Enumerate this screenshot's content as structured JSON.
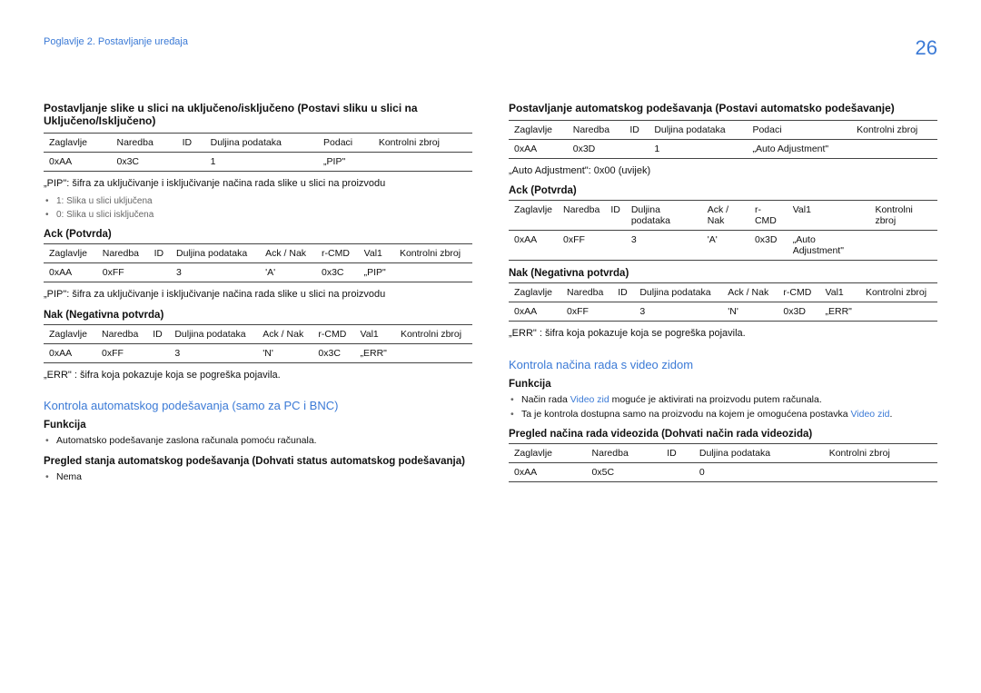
{
  "chapter": "Poglavlje 2. Postavljanje uređaja",
  "page": "26",
  "left": {
    "title1": "Postavljanje slike u slici na uključeno/isključeno (Postavi sliku u slici na Uključeno/Isključeno)",
    "t1h": [
      "Zaglavlje",
      "Naredba",
      "ID",
      "Duljina podataka",
      "Podaci",
      "Kontrolni zbroj"
    ],
    "t1r": [
      "0xAA",
      "0x3C",
      "",
      "1",
      "„PIP\"",
      ""
    ],
    "desc1": "„PIP\": šifra za uključivanje i isključivanje načina rada slike u slici na proizvodu",
    "b1": "1: Slika u slici uključena",
    "b2": "0: Slika u slici isključena",
    "ack": "Ack (Potvrda)",
    "t2h": [
      "Zaglavlje",
      "Naredba",
      "ID",
      "Duljina podataka",
      "Ack / Nak",
      "r-CMD",
      "Val1",
      "Kontrolni zbroj"
    ],
    "t2r": [
      "0xAA",
      "0xFF",
      "",
      "3",
      "'A'",
      "0x3C",
      "„PIP\"",
      ""
    ],
    "desc2": "„PIP\": šifra za uključivanje i isključivanje načina rada slike u slici na proizvodu",
    "nak": "Nak (Negativna potvrda)",
    "t3r": [
      "0xAA",
      "0xFF",
      "",
      "3",
      "'N'",
      "0x3C",
      "„ERR\"",
      ""
    ],
    "err": "„ERR\" : šifra koja pokazuje koja se pogreška pojavila.",
    "sec": "Kontrola automatskog podešavanja (samo za PC i BNC)",
    "func": "Funkcija",
    "fb1": "Automatsko podešavanje zaslona računala pomoću računala.",
    "preg": "Pregled stanja automatskog podešavanja (Dohvati status automatskog podešavanja)",
    "nema": "Nema"
  },
  "right": {
    "title1": "Postavljanje automatskog podešavanja (Postavi automatsko podešavanje)",
    "t1h": [
      "Zaglavlje",
      "Naredba",
      "ID",
      "Duljina podataka",
      "Podaci",
      "Kontrolni zbroj"
    ],
    "t1r": [
      "0xAA",
      "0x3D",
      "",
      "1",
      "„Auto Adjustment\"",
      ""
    ],
    "desc1": "„Auto Adjustment\": 0x00 (uvijek)",
    "ack": "Ack (Potvrda)",
    "t2h": [
      "Zaglavlje",
      "Naredba",
      "ID",
      "Duljina podataka",
      "Ack / Nak",
      "r-CMD",
      "Val1",
      "Kontrolni zbroj"
    ],
    "t2r": [
      "0xAA",
      "0xFF",
      "",
      "3",
      "'A'",
      "0x3D",
      "„Auto Adjustment\"",
      ""
    ],
    "nak": "Nak (Negativna potvrda)",
    "t3r": [
      "0xAA",
      "0xFF",
      "",
      "3",
      "'N'",
      "0x3D",
      "„ERR\"",
      ""
    ],
    "err": "„ERR\" : šifra koja pokazuje koja se pogreška pojavila.",
    "sec": "Kontrola načina rada s video zidom",
    "func": "Funkcija",
    "fb1a": "Način rada ",
    "fb1link": "Video zid",
    "fb1b": " moguće je aktivirati na proizvodu putem računala.",
    "fb2a": "Ta je kontrola dostupna samo na proizvodu na kojem je omogućena postavka ",
    "fb2link": "Video zid",
    "fb2b": ".",
    "preg": "Pregled načina rada videozida (Dohvati način rada videozida)",
    "t4h": [
      "Zaglavlje",
      "Naredba",
      "ID",
      "Duljina podataka",
      "Kontrolni zbroj"
    ],
    "t4r": [
      "0xAA",
      "0x5C",
      "",
      "0",
      ""
    ]
  }
}
